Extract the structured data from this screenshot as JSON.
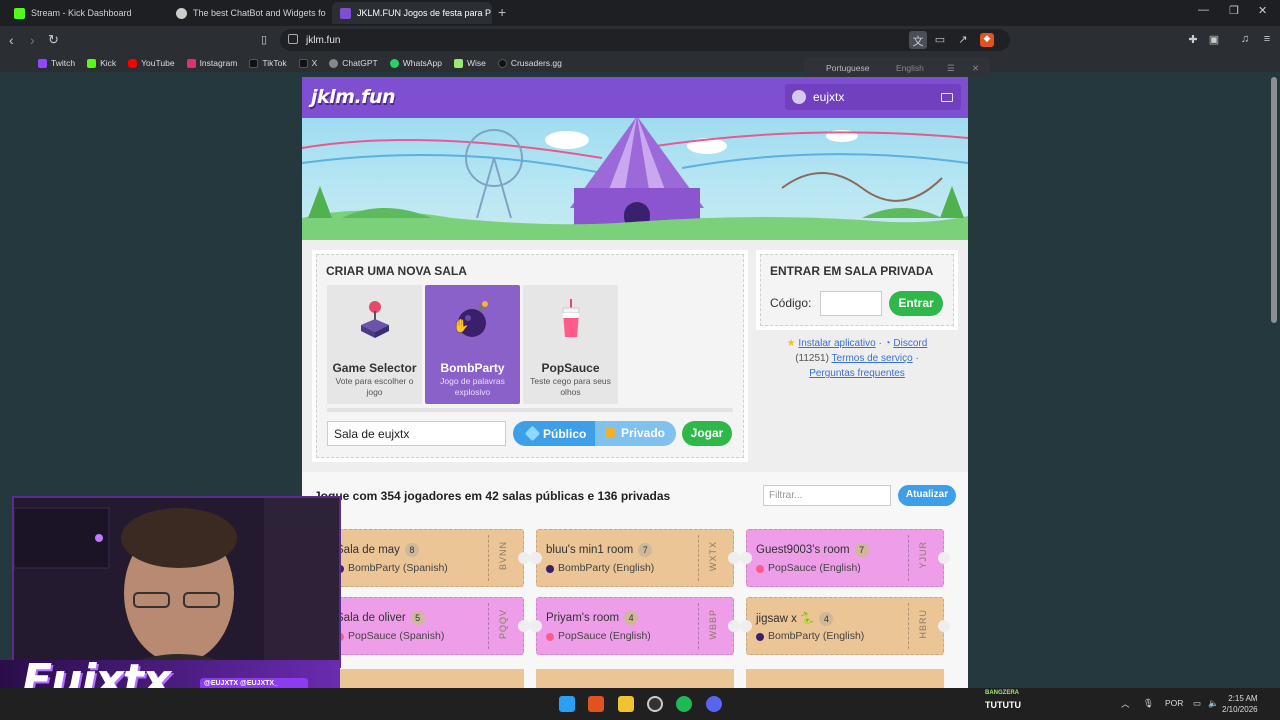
{
  "browser": {
    "tabs": [
      {
        "title": "Stream - Kick Dashboard",
        "color": "#53fc18"
      },
      {
        "title": "The best ChatBot and Widgets fo",
        "color": "#cccccc"
      },
      {
        "title": "JKLM.FUN Jogos de festa para P",
        "color": "#7e4fd0"
      }
    ],
    "url": "jklm.fun",
    "bookmarks": [
      {
        "label": "Twitch",
        "color": "#9146ff"
      },
      {
        "label": "Kick",
        "color": "#53fc18"
      },
      {
        "label": "YouTube",
        "color": "#ff0000"
      },
      {
        "label": "Instagram",
        "color": "#e1306c"
      },
      {
        "label": "TikTok",
        "color": "#111111"
      },
      {
        "label": "X",
        "color": "#111111"
      },
      {
        "label": "ChatGPT",
        "color": "#888888"
      },
      {
        "label": "WhatsApp",
        "color": "#25d366"
      },
      {
        "label": "Wise",
        "color": "#9fe870"
      },
      {
        "label": "Crusaders.gg",
        "color": "#111111"
      }
    ],
    "translate": {
      "from": "Portuguese",
      "to": "English"
    }
  },
  "site": {
    "logo": "jklm.fun",
    "username": "eujxtx"
  },
  "create": {
    "title": "CRIAR UMA NOVA SALA",
    "games": [
      {
        "name": "Game Selector",
        "desc": "Vote para escolher o jogo"
      },
      {
        "name": "BombParty",
        "desc": "Jogo de palavras explosivo"
      },
      {
        "name": "PopSauce",
        "desc": "Teste cego para seus olhos"
      }
    ],
    "room_name": "Sala de eujxtx",
    "public_label": "Público",
    "private_label": "Privado",
    "play_label": "Jogar"
  },
  "join": {
    "title": "ENTRAR EM SALA PRIVADA",
    "code_label": "Código:",
    "enter_label": "Entrar",
    "install": "Instalar aplicativo",
    "discord": "Discord",
    "online": "(11251)",
    "terms": "Termos de serviço",
    "faq": "Perguntas frequentes"
  },
  "rooms": {
    "summary": "Jogue com 354 jogadores em 42 salas públicas e 136 privadas",
    "filter_placeholder": "Filtrar...",
    "refresh_label": "Atualizar",
    "list": [
      {
        "name": "Sala de may",
        "count": "8",
        "game": "BombParty (Spanish)",
        "code": "BVNN",
        "kind": "bomb"
      },
      {
        "name": "bluu's min1 room",
        "count": "7",
        "game": "BombParty (English)",
        "code": "WXTX",
        "kind": "bomb"
      },
      {
        "name": "Guest9003's room",
        "count": "7",
        "game": "PopSauce (English)",
        "code": "YJUR",
        "kind": "pop"
      },
      {
        "name": "Sala de oliver",
        "count": "5",
        "game": "PopSauce (Spanish)",
        "code": "PQQV",
        "kind": "pop"
      },
      {
        "name": "Priyam's room",
        "count": "4",
        "game": "PopSauce (English)",
        "code": "WBBP",
        "kind": "pop"
      },
      {
        "name": "jigsaw x 🐍",
        "count": "4",
        "game": "BombParty (English)",
        "code": "HBRU",
        "kind": "bomb"
      }
    ]
  },
  "overlay": {
    "streamer": "Eujxtx",
    "tags": "@EUJXTX  @EUJXTX_"
  },
  "taskbar": {
    "now_playing_title": "BANGZERA",
    "now_playing": "TUTUTU",
    "lang": "POR",
    "time": "2:15 AM",
    "date": "2/10/2026"
  }
}
